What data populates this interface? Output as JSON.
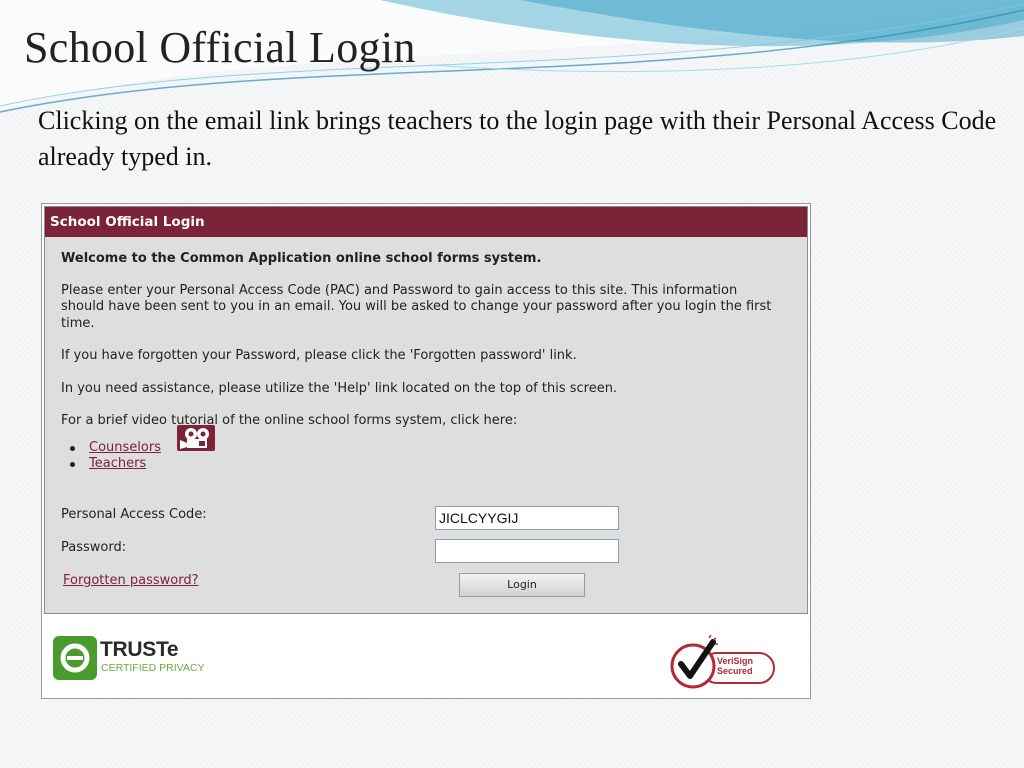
{
  "slide": {
    "title": "School Official Login",
    "body": "Clicking on the email link brings teachers to the login page with their Personal Access Code already typed in."
  },
  "panel": {
    "header": "School Official Login",
    "welcome": "Welcome to the Common Application online school forms system.",
    "paragraphs": [
      "Please enter your Personal Access Code (PAC) and Password to gain access to this site. This information should have been sent to you in an email. You will be asked to change your password after you login the first time.",
      "If you have forgotten your Password, please click the 'Forgotten password' link.",
      "In you need assistance, please utilize the 'Help' link located on the top of this screen.",
      "For a brief video tutorial of the online school forms system, click here:"
    ],
    "tutorial_links": [
      "Counselors",
      "Teachers"
    ],
    "pac_label": "Personal Access Code:",
    "pac_value": "JICLCYYGIJ",
    "password_label": "Password:",
    "password_value": "",
    "forgot_link": "Forgotten password?",
    "login_button": "Login"
  },
  "badges": {
    "truste_name": "TRUSTe",
    "truste_sub": "CERTIFIED PRIVACY",
    "verisign_line1": "VeriSign",
    "verisign_line2": "Secured"
  },
  "colors": {
    "header_bg": "#7b2338",
    "panel_bg": "#dedede",
    "link": "#7b2338",
    "truste_green": "#6aaa3a",
    "verisign_red": "#b12a35"
  },
  "icons": {
    "video": "video-camera-icon",
    "truste": "truste-seal-icon",
    "verisign": "verisign-checkmark-icon"
  }
}
